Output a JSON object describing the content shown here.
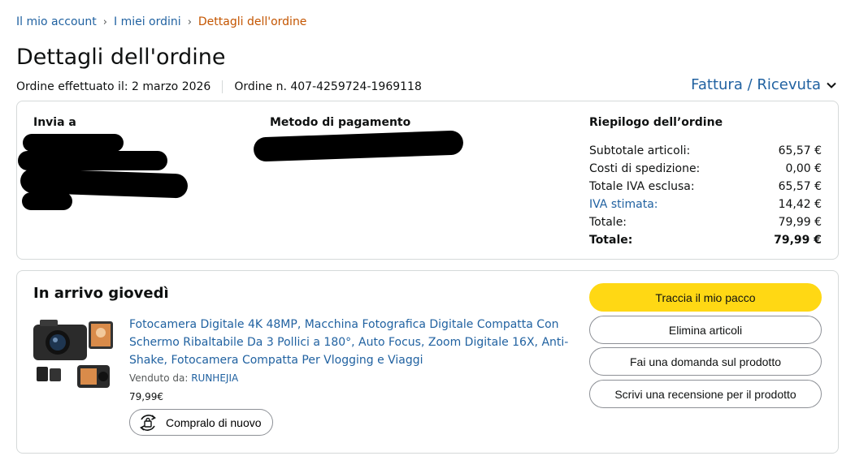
{
  "breadcrumb": {
    "account": "Il mio account",
    "orders": "I miei ordini",
    "current": "Dettagli dell'ordine",
    "separator": "›"
  },
  "page": {
    "title": "Dettagli dell'ordine",
    "order_date": "Ordine effettuato il: 2 marzo 2026",
    "order_number": "Ordine n. 407-4259724-1969118",
    "invoice_link": "Fattura / Ricevuta"
  },
  "shipping": {
    "title": "Invia a"
  },
  "payment": {
    "title": "Metodo di pagamento"
  },
  "summary": {
    "title": "Riepilogo dell’ordine",
    "rows": [
      {
        "label": "Subtotale articoli:",
        "value": "65,57 €"
      },
      {
        "label": "Costi di spedizione:",
        "value": "0,00 €"
      },
      {
        "label": "Totale IVA esclusa:",
        "value": "65,57 €"
      },
      {
        "label": "IVA stimata:",
        "value": "14,42 €"
      },
      {
        "label": "Totale:",
        "value": "79,99 €"
      },
      {
        "label": "Totale:",
        "value": "79,99 €"
      }
    ]
  },
  "shipment": {
    "status": "In arrivo giovedì",
    "product_title": "Fotocamera Digitale 4K 48MP, Macchina Fotografica Digitale Compatta Con Schermo Ribaltabile Da 3 Pollici a 180°, Auto Focus, Zoom Digitale 16X, Anti-Shake, Fotocamera Compatta Per Vlogging e Viaggi",
    "sold_by_label": "Venduto da:",
    "seller": "RUNHEJIA",
    "price": "79,99€",
    "buy_again": "Compralo di nuovo"
  },
  "actions": {
    "track": "Traccia il mio pacco",
    "delete": "Elimina articoli",
    "ask": "Fai una domanda sul prodotto",
    "review": "Scrivi una recensione per il prodotto"
  },
  "colors": {
    "link": "#2162a1",
    "breadcrumb_current": "#c45500",
    "primary_button": "#ffd814",
    "border": "#d5d9d9"
  }
}
